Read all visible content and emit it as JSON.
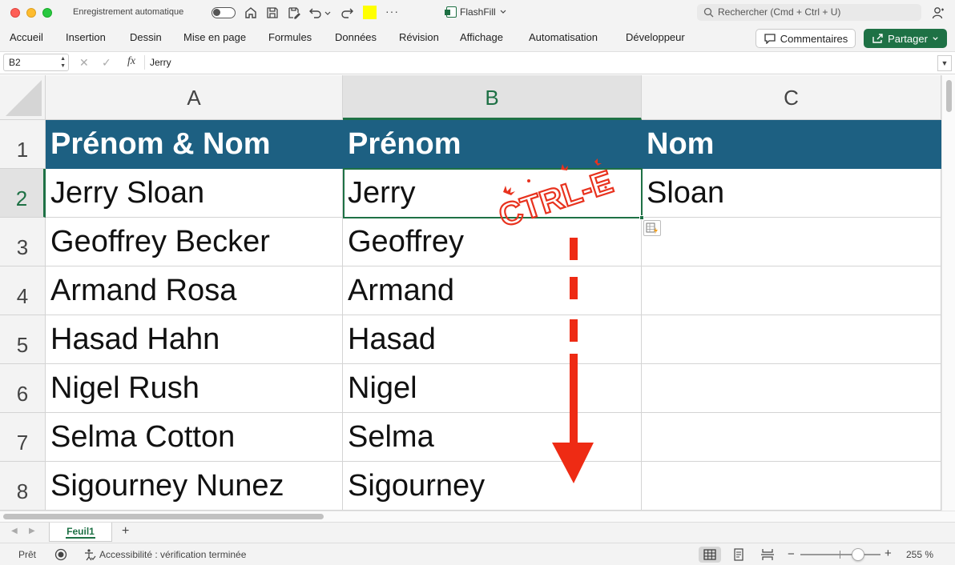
{
  "titlebar": {
    "autosave_label": "Enregistrement automatique",
    "doc_title": "FlashFill",
    "search_placeholder": "Rechercher (Cmd + Ctrl + U)",
    "more": "···"
  },
  "ribbon": {
    "tabs": [
      "Accueil",
      "Insertion",
      "Dessin",
      "Mise en page",
      "Formules",
      "Données",
      "Révision",
      "Affichage",
      "Automatisation",
      "Développeur"
    ],
    "comments_label": "Commentaires",
    "share_label": "Partager"
  },
  "formula_bar": {
    "name_box": "B2",
    "fx_label": "fx",
    "value": "Jerry"
  },
  "sheet": {
    "columns": [
      "A",
      "B",
      "C"
    ],
    "selected_column": "B",
    "rows": [
      "1",
      "2",
      "3",
      "4",
      "5",
      "6",
      "7",
      "8"
    ],
    "selected_row": "2",
    "header_row": [
      "Prénom & Nom",
      "Prénom",
      "Nom"
    ],
    "header_color": "#1d6082",
    "data": [
      [
        "Jerry Sloan",
        "Jerry",
        "Sloan"
      ],
      [
        "Geoffrey Becker",
        "Geoffrey",
        ""
      ],
      [
        "Armand Rosa",
        "Armand",
        ""
      ],
      [
        "Hasad Hahn",
        "Hasad",
        ""
      ],
      [
        "Nigel Rush",
        "Nigel",
        ""
      ],
      [
        "Selma Cotton",
        "Selma",
        ""
      ],
      [
        "Sigourney Nunez",
        "Sigourney",
        ""
      ]
    ],
    "active_cell": "B2"
  },
  "annotation": {
    "stamp_text": "CTRL-E",
    "color": "#e8321e"
  },
  "sheet_tabs": {
    "tabs": [
      "Feuil1"
    ],
    "add": "+"
  },
  "status_bar": {
    "ready": "Prêt",
    "accessibility": "Accessibilité : vérification terminée",
    "zoom_minus": "−",
    "zoom_plus": "+",
    "zoom_level": "255 %"
  }
}
